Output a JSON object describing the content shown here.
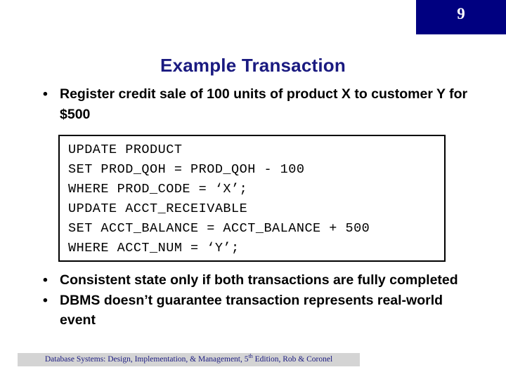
{
  "slide": {
    "number": "9",
    "number_bar_color": "#000080",
    "title": "Example Transaction",
    "title_color": "#1a1a80"
  },
  "bullets_top": [
    {
      "marker": "•",
      "text": "Register credit sale of 100 units of product X to customer Y for $500"
    }
  ],
  "code_box": {
    "lines": [
      "UPDATE PRODUCT",
      "SET PROD_QOH = PROD_QOH - 100",
      "WHERE PROD_CODE = ‘X’;",
      "UPDATE ACCT_RECEIVABLE",
      "SET ACCT_BALANCE = ACCT_BALANCE + 500",
      "WHERE ACCT_NUM = ‘Y’;"
    ],
    "border_color": "#000000"
  },
  "bullets_bottom": [
    {
      "marker": "•",
      "text": "Consistent state only if both transactions are fully completed"
    },
    {
      "marker": "•",
      "text": "DBMS doesn’t guarantee transaction represents real-world event"
    }
  ],
  "footer": {
    "prefix": "Database Systems: Design, Implementation, & Management, 5",
    "superscript": "th",
    "suffix": " Edition, Rob & Coronel",
    "background_color": "#d4d4d4",
    "text_color": "#1a1a80"
  }
}
